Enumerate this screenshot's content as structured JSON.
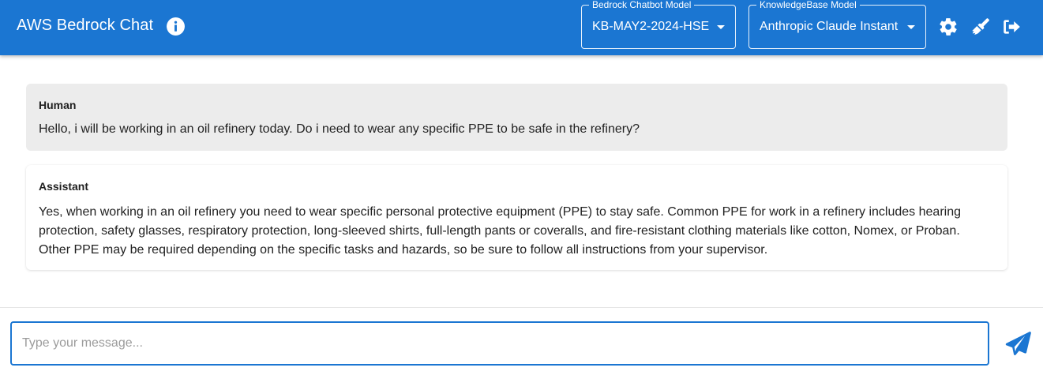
{
  "app": {
    "title": "AWS Bedrock Chat",
    "accent_color": "#1b76d2"
  },
  "header": {
    "info_icon": "info-icon",
    "chatbot_model": {
      "label": "Bedrock Chatbot Model",
      "value": "KB-MAY2-2024-HSE"
    },
    "knowledgebase_model": {
      "label": "KnowledgeBase Model",
      "value": "Anthropic Claude Instant"
    },
    "actions": [
      "gear-icon",
      "broom-icon",
      "logout-icon"
    ]
  },
  "messages": [
    {
      "role": "Human",
      "text": "Hello, i will be working in an oil refinery today. Do i need to wear any specific PPE to be safe in the refinery?"
    },
    {
      "role": "Assistant",
      "text": "Yes, when working in an oil refinery you need to wear specific personal protective equipment (PPE) to stay safe. Common PPE for work in a refinery includes hearing protection, safety glasses, respiratory protection, long-sleeved shirts, full-length pants or coveralls, and fire-resistant clothing materials like cotton, Nomex, or Proban. Other PPE may be required depending on the specific tasks and hazards, so be sure to follow all instructions from your supervisor."
    }
  ],
  "composer": {
    "value": "",
    "placeholder": "Type your message...",
    "send_icon": "send-icon"
  }
}
